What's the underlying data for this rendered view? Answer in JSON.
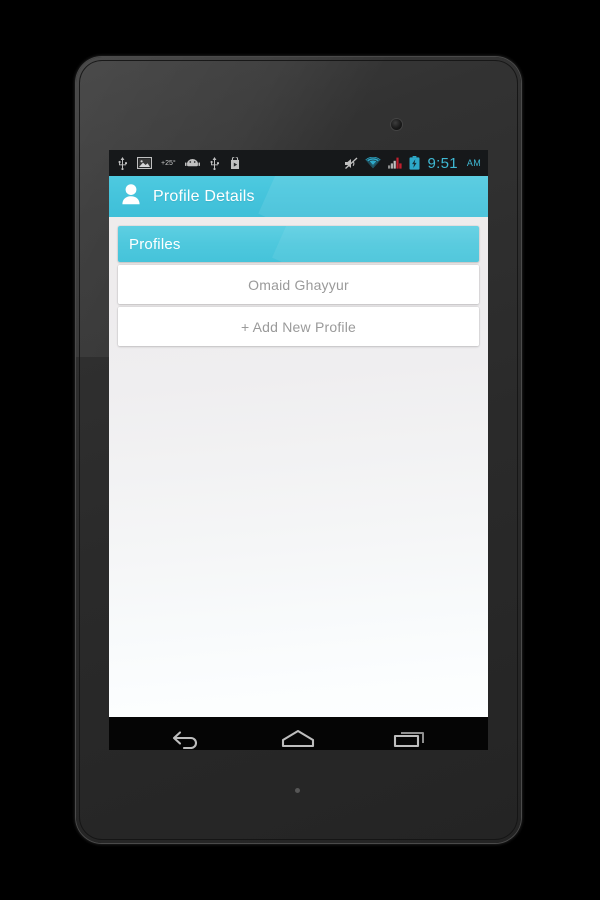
{
  "device": {
    "type": "android-tablet",
    "camera": "front-camera",
    "body_color": "#2b2b2b"
  },
  "status_bar": {
    "background": "#16181a",
    "left_icons": [
      {
        "name": "usb-icon",
        "label": "USB"
      },
      {
        "name": "screenshot-image-icon",
        "label": "Screenshot"
      },
      {
        "name": "temperature-indicator",
        "label": "+25°"
      },
      {
        "name": "android-head-icon",
        "label": "Android"
      },
      {
        "name": "usb-icon-2",
        "label": "USB"
      },
      {
        "name": "play-store-icon",
        "label": "Play Store"
      }
    ],
    "right_icons": [
      {
        "name": "mute-icon",
        "label": "Silent mode"
      },
      {
        "name": "wifi-icon",
        "label": "Wi-Fi",
        "color": "#2fb6d8"
      },
      {
        "name": "cell-signal-icon",
        "label": "Mobile signal",
        "color": "#d02030"
      },
      {
        "name": "battery-charging-icon",
        "label": "Battery charging",
        "color": "#2fb6d8"
      }
    ],
    "time": "9:51",
    "time_period": "AM",
    "clock_color": "#3fb9d4"
  },
  "action_bar": {
    "icon": "person-icon",
    "title": "Profile Details",
    "background_color": "#45c4dc",
    "text_color": "#ffffff"
  },
  "card": {
    "header": {
      "title": "Profiles",
      "background_color": "#4ec8dd",
      "text_color": "#ffffff"
    },
    "rows": [
      {
        "name": "profile-row",
        "label": "Omaid Ghayyur"
      },
      {
        "name": "add-profile-row",
        "label": "+ Add New Profile"
      }
    ]
  },
  "nav_bar": {
    "background": "#050505",
    "buttons": [
      {
        "name": "nav-back-button",
        "label": "Back"
      },
      {
        "name": "nav-home-button",
        "label": "Home"
      },
      {
        "name": "nav-recents-button",
        "label": "Recent apps"
      }
    ]
  }
}
